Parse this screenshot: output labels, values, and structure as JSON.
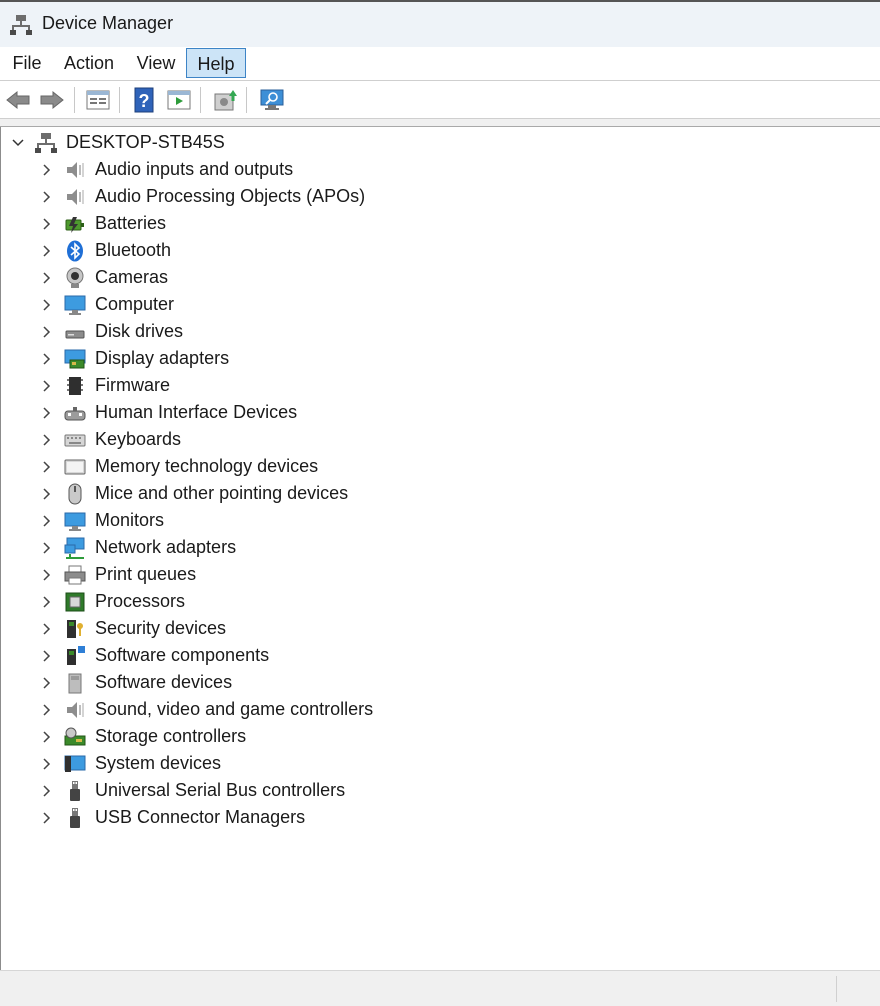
{
  "window": {
    "title": "Device Manager"
  },
  "menu": {
    "items": [
      {
        "label": "File"
      },
      {
        "label": "Action"
      },
      {
        "label": "View"
      },
      {
        "label": "Help"
      }
    ],
    "active": "Help"
  },
  "toolbar": {
    "buttons": [
      "back-icon",
      "forward-icon",
      "properties-icon",
      "help-icon",
      "run-icon",
      "update-driver-icon",
      "scan-hardware-icon"
    ]
  },
  "tree": {
    "root": {
      "label": "DESKTOP-STB45S",
      "icon": "computer-network-icon",
      "expanded": true
    },
    "categories": [
      {
        "label": "Audio inputs and outputs",
        "icon": "speaker-icon"
      },
      {
        "label": "Audio Processing Objects (APOs)",
        "icon": "speaker-icon"
      },
      {
        "label": "Batteries",
        "icon": "battery-icon"
      },
      {
        "label": "Bluetooth",
        "icon": "bluetooth-icon"
      },
      {
        "label": "Cameras",
        "icon": "camera-icon"
      },
      {
        "label": "Computer",
        "icon": "computer-icon"
      },
      {
        "label": "Disk drives",
        "icon": "disk-drive-icon"
      },
      {
        "label": "Display adapters",
        "icon": "display-adapter-icon"
      },
      {
        "label": "Firmware",
        "icon": "firmware-icon"
      },
      {
        "label": "Human Interface Devices",
        "icon": "hid-icon"
      },
      {
        "label": "Keyboards",
        "icon": "keyboard-icon"
      },
      {
        "label": "Memory technology devices",
        "icon": "memory-icon"
      },
      {
        "label": "Mice and other pointing devices",
        "icon": "mouse-icon"
      },
      {
        "label": "Monitors",
        "icon": "monitor-icon"
      },
      {
        "label": "Network adapters",
        "icon": "network-adapter-icon"
      },
      {
        "label": "Print queues",
        "icon": "printer-icon"
      },
      {
        "label": "Processors",
        "icon": "processor-icon"
      },
      {
        "label": "Security devices",
        "icon": "security-device-icon"
      },
      {
        "label": "Software components",
        "icon": "software-component-icon"
      },
      {
        "label": "Software devices",
        "icon": "software-device-icon"
      },
      {
        "label": "Sound, video and game controllers",
        "icon": "speaker-icon"
      },
      {
        "label": "Storage controllers",
        "icon": "storage-controller-icon"
      },
      {
        "label": "System devices",
        "icon": "system-device-icon"
      },
      {
        "label": "Universal Serial Bus controllers",
        "icon": "usb-icon"
      },
      {
        "label": "USB Connector Managers",
        "icon": "usb-icon"
      }
    ]
  },
  "colors": {
    "accent": "#3d84c6",
    "menu_active_bg": "#cce4f7",
    "titlebar_bg": "#eef3f8"
  }
}
